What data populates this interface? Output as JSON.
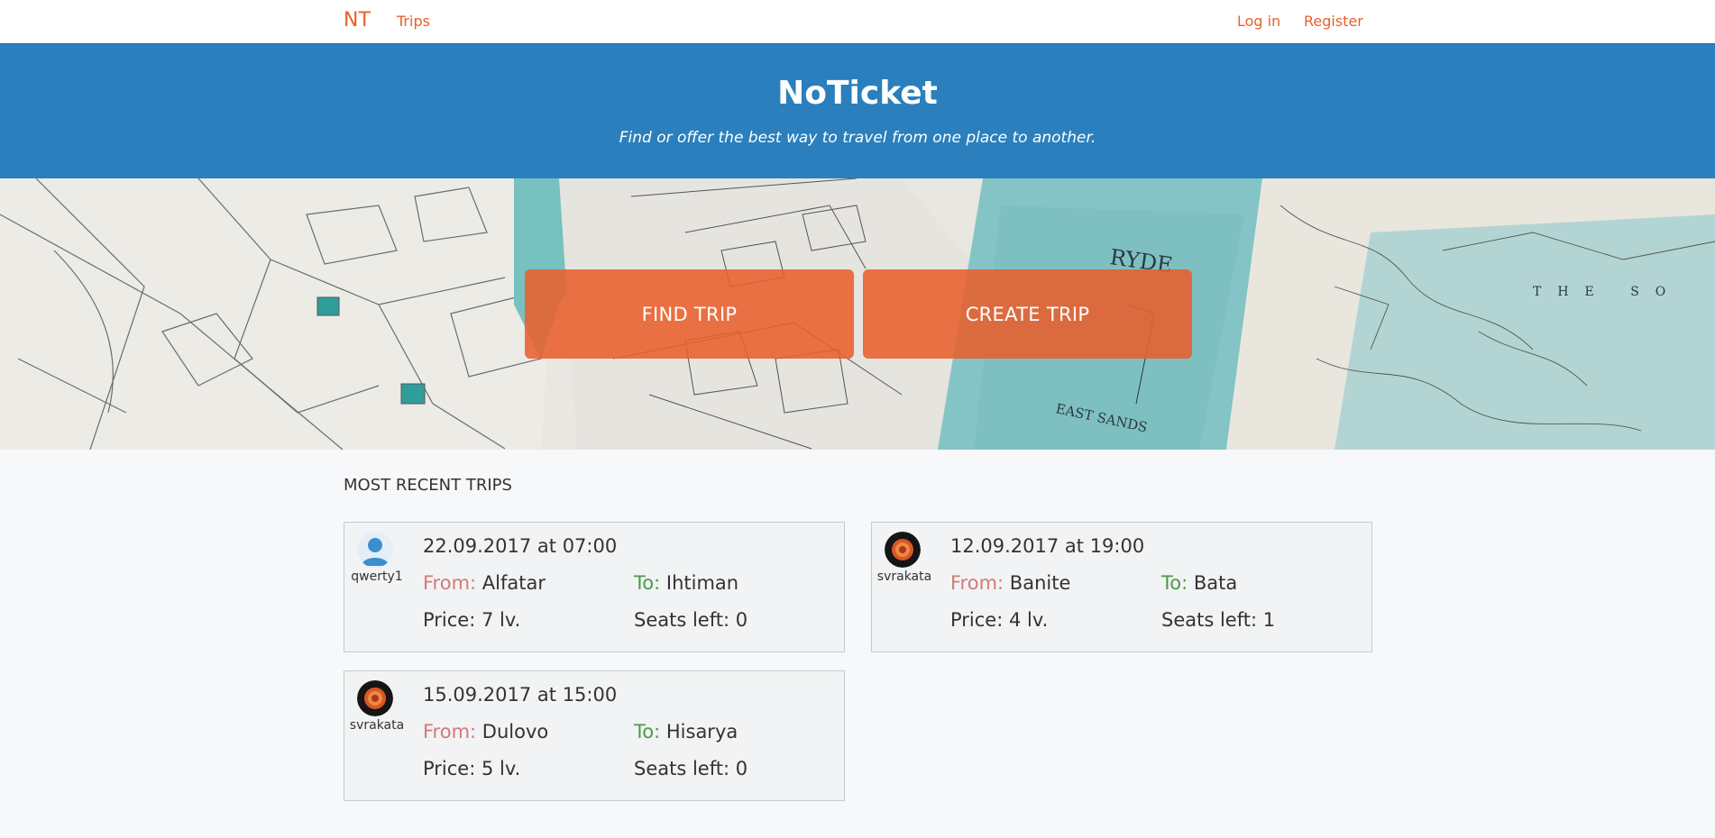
{
  "navbar": {
    "brand": "NT",
    "links": {
      "trips": "Trips",
      "login": "Log in",
      "register": "Register"
    }
  },
  "hero": {
    "title": "NoTicket",
    "subtitle": "Find or offer the best way to travel from one place to another."
  },
  "actions": {
    "find": "FIND TRIP",
    "create": "CREATE TRIP"
  },
  "recent": {
    "title": "MOST RECENT TRIPS",
    "from_label": "From:",
    "to_label": "To:",
    "trips": [
      {
        "user": "qwerty1",
        "avatar": "default-user-icon",
        "date": "22.09.2017 at 07:00",
        "from": "Alfatar",
        "to": "Ihtiman",
        "price": "Price: 7 lv.",
        "seats": "Seats left: 0"
      },
      {
        "user": "svrakata",
        "avatar": "fireball-avatar",
        "date": "12.09.2017 at 19:00",
        "from": "Banite",
        "to": "Bata",
        "price": "Price: 4 lv.",
        "seats": "Seats left: 1"
      },
      {
        "user": "svrakata",
        "avatar": "fireball-avatar",
        "date": "15.09.2017 at 15:00",
        "from": "Dulovo",
        "to": "Hisarya",
        "price": "Price: 5 lv.",
        "seats": "Seats left: 0"
      }
    ]
  },
  "colors": {
    "accent": "#e8602c",
    "hero_blue": "#2a7fbc",
    "from_label": "#d37a78",
    "to_label": "#4a9a4a"
  }
}
